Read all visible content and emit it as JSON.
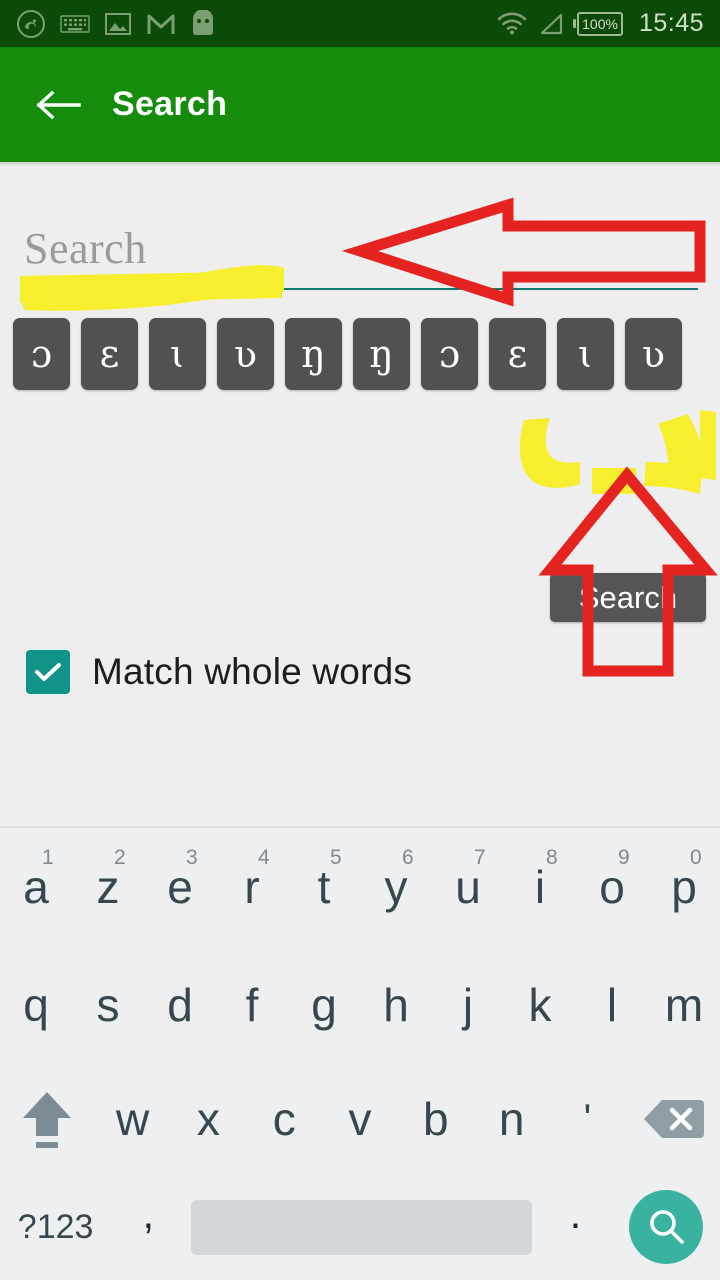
{
  "status_bar": {
    "background": "#0c4a07",
    "time": "15:45",
    "battery_text": "100%",
    "left_icons": [
      "app-logo-icon",
      "keyboard-icon",
      "image-icon",
      "gmail-icon",
      "android-head-icon"
    ],
    "right_icons": [
      "wifi-icon",
      "signal-icon",
      "battery-icon"
    ]
  },
  "app_bar": {
    "background": "#158c0c",
    "back_icon": "arrow-back-icon",
    "title": "Search"
  },
  "main": {
    "search_input": {
      "value": "",
      "placeholder": "Search",
      "underline_color": "#10796e"
    },
    "phonetic_keys": [
      {
        "label": "ɔ"
      },
      {
        "label": "ɛ"
      },
      {
        "label": "ɩ"
      },
      {
        "label": "ʋ"
      },
      {
        "label": "ŋ"
      },
      {
        "label": "ŋ"
      },
      {
        "label": "ɔ"
      },
      {
        "label": "ɛ"
      },
      {
        "label": "ɩ"
      },
      {
        "label": "ʋ"
      }
    ],
    "search_button": {
      "label": "Search",
      "background": "#555555"
    },
    "match_whole_words": {
      "label": "Match whole words",
      "checked": true,
      "checkbox_color": "#109487",
      "check_icon": "checkmark-icon"
    }
  },
  "annotations": {
    "highlight_color": "#f7ee2d",
    "arrow_color": "#e52321",
    "arrows": [
      {
        "name": "left-arrow-pointing-to-search-field",
        "direction": "left"
      },
      {
        "name": "up-arrow-pointing-to-search-button",
        "direction": "up"
      }
    ],
    "highlights": [
      {
        "name": "highlight-under-search-field"
      },
      {
        "name": "highlight-around-search-button"
      }
    ]
  },
  "keyboard": {
    "background": "#edeff1",
    "row1": [
      {
        "label": "a",
        "number": "1"
      },
      {
        "label": "z",
        "number": "2"
      },
      {
        "label": "e",
        "number": "3"
      },
      {
        "label": "r",
        "number": "4"
      },
      {
        "label": "t",
        "number": "5"
      },
      {
        "label": "y",
        "number": "6"
      },
      {
        "label": "u",
        "number": "7"
      },
      {
        "label": "i",
        "number": "8"
      },
      {
        "label": "o",
        "number": "9"
      },
      {
        "label": "p",
        "number": "0"
      }
    ],
    "row2": [
      {
        "label": "q"
      },
      {
        "label": "s"
      },
      {
        "label": "d"
      },
      {
        "label": "f"
      },
      {
        "label": "g"
      },
      {
        "label": "h"
      },
      {
        "label": "j"
      },
      {
        "label": "k"
      },
      {
        "label": "l"
      },
      {
        "label": "m"
      }
    ],
    "row3": {
      "shift_icon": "shift-icon",
      "keys": [
        {
          "label": "w"
        },
        {
          "label": "x"
        },
        {
          "label": "c"
        },
        {
          "label": "v"
        },
        {
          "label": "b"
        },
        {
          "label": "n"
        },
        {
          "label": "'"
        }
      ],
      "backspace_icon": "backspace-icon"
    },
    "row4": {
      "symbols_label": "?123",
      "comma_label": ",",
      "space_label": "",
      "period_label": ".",
      "enter_icon": "search-icon",
      "enter_color": "#39b2a0"
    }
  }
}
